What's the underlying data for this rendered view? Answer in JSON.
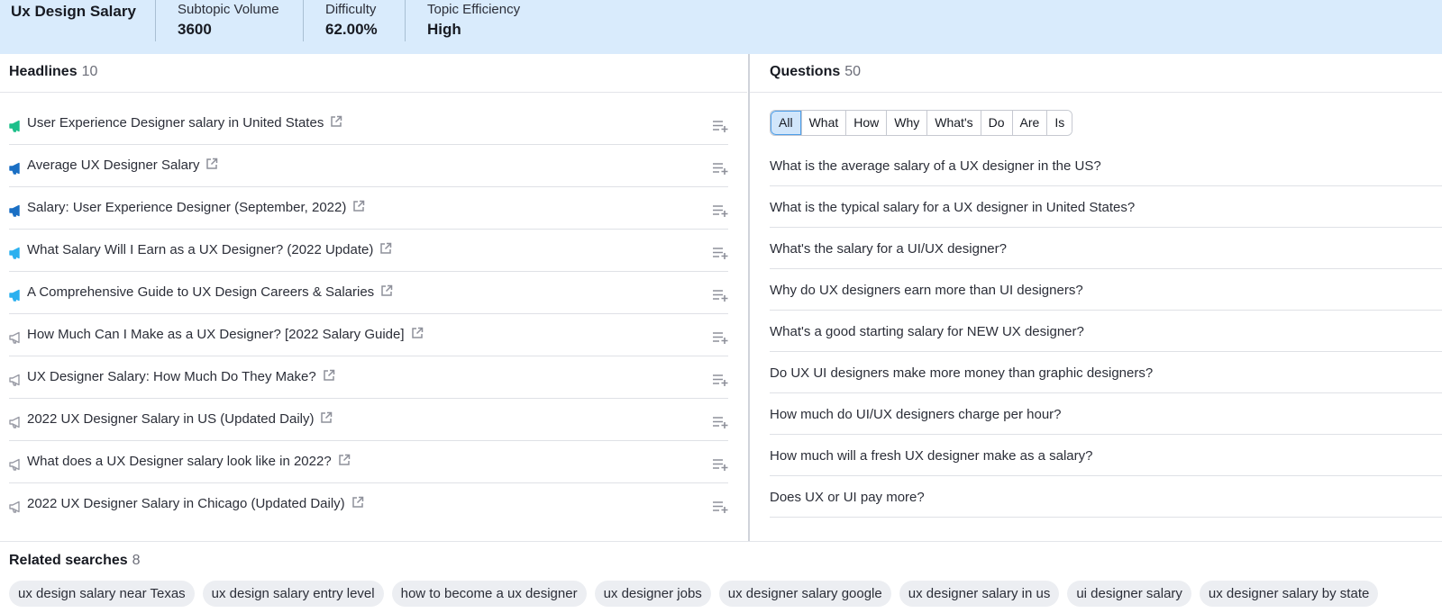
{
  "header": {
    "title": "Ux Design Salary",
    "stats": [
      {
        "label": "Subtopic Volume",
        "value": "3600"
      },
      {
        "label": "Difficulty",
        "value": "62.00%"
      },
      {
        "label": "Topic Efficiency",
        "value": "High"
      }
    ]
  },
  "headlines": {
    "title": "Headlines",
    "count": "10",
    "items": [
      {
        "text": "User Experience Designer salary in United States",
        "icon_color": "#1dbf8a"
      },
      {
        "text": "Average UX Designer Salary",
        "icon_color": "#1a6fc4"
      },
      {
        "text": "Salary: User Experience Designer (September, 2022)",
        "icon_color": "#1a6fc4"
      },
      {
        "text": "What Salary Will I Earn as a UX Designer? (2022 Update)",
        "icon_color": "#2bb0ef"
      },
      {
        "text": "A Comprehensive Guide to UX Design Careers & Salaries",
        "icon_color": "#2bb0ef"
      },
      {
        "text": "How Much Can I Make as a UX Designer? [2022 Salary Guide]",
        "icon_color": "#9a9ca6"
      },
      {
        "text": "UX Designer Salary: How Much Do They Make?",
        "icon_color": "#9a9ca6"
      },
      {
        "text": "2022 UX Designer Salary in US (Updated Daily)",
        "icon_color": "#9a9ca6"
      },
      {
        "text": "What does a UX Designer salary look like in 2022?",
        "icon_color": "#9a9ca6"
      },
      {
        "text": "2022 UX Designer Salary in Chicago (Updated Daily)",
        "icon_color": "#9a9ca6"
      }
    ]
  },
  "questions": {
    "title": "Questions",
    "count": "50",
    "filters": [
      "All",
      "What",
      "How",
      "Why",
      "What's",
      "Do",
      "Are",
      "Is"
    ],
    "active_filter": "All",
    "items": [
      "What is the average salary of a UX designer in the US?",
      "What is the typical salary for a UX designer in United States?",
      "What's the salary for a UI/UX designer?",
      "Why do UX designers earn more than UI designers?",
      "What's a good starting salary for NEW UX designer?",
      "Do UX UI designers make more money than graphic designers?",
      "How much do UI/UX designers charge per hour?",
      "How much will a fresh UX designer make as a salary?",
      "Does UX or UI pay more?"
    ]
  },
  "related": {
    "title": "Related searches",
    "count": "8",
    "chips": [
      "ux design salary near Texas",
      "ux design salary entry level",
      "how to become a ux designer",
      "ux designer jobs",
      "ux designer salary google",
      "ux designer salary in us",
      "ui designer salary",
      "ux designer salary by state"
    ]
  },
  "colors": {
    "header_bg": "#d9ebfc",
    "active_filter_bg": "#d1e6fb",
    "active_filter_border": "#4d9ee8",
    "chip_bg": "#eceef2"
  }
}
